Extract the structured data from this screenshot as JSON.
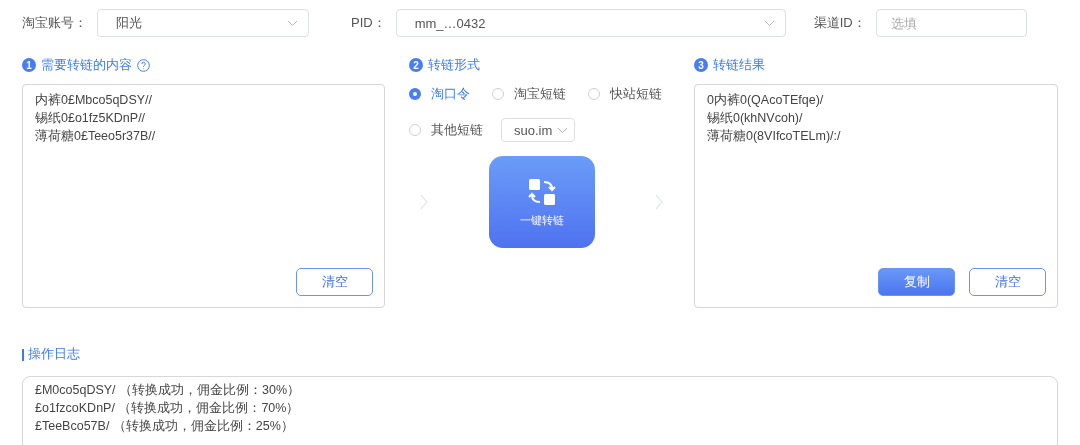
{
  "account": {
    "label": "淘宝账号：",
    "value": "阳光"
  },
  "pid": {
    "label": "PID：",
    "value": "mm_…0432"
  },
  "channel": {
    "label": "渠道ID：",
    "placeholder": "选填"
  },
  "input_panel": {
    "step": "1",
    "title": "需要转链的内容",
    "lines": [
      "内裤0£Mbco5qDSY//",
      "锡纸0£o1fz5KDnP//",
      "薄荷糖0£Teeo5r37B//"
    ],
    "clear_button": "清空"
  },
  "format_panel": {
    "step": "2",
    "title": "转链形式",
    "options": [
      {
        "label": "淘口令",
        "selected": true
      },
      {
        "label": "淘宝短链",
        "selected": false
      },
      {
        "label": "快站短链",
        "selected": false
      },
      {
        "label": "其他短链",
        "selected": false
      }
    ],
    "short_domain": "suo.im",
    "convert_button": "一键转链"
  },
  "result_panel": {
    "step": "3",
    "title": "转链结果",
    "lines": [
      "0内裤0(QAcoTEfqe)/",
      "锡纸0(khNVcoh)/",
      "薄荷糖0(8VIfcoTELm)/:/"
    ],
    "copy_button": "复制",
    "clear_button": "清空"
  },
  "log": {
    "title": "操作日志",
    "entries": [
      "£M0co5qDSY/ （转换成功，佣金比例：30%）",
      "£o1fzcoKDnP/ （转换成功，佣金比例：70%）",
      "£TeeBco57B/ （转换成功，佣金比例：25%）"
    ]
  }
}
